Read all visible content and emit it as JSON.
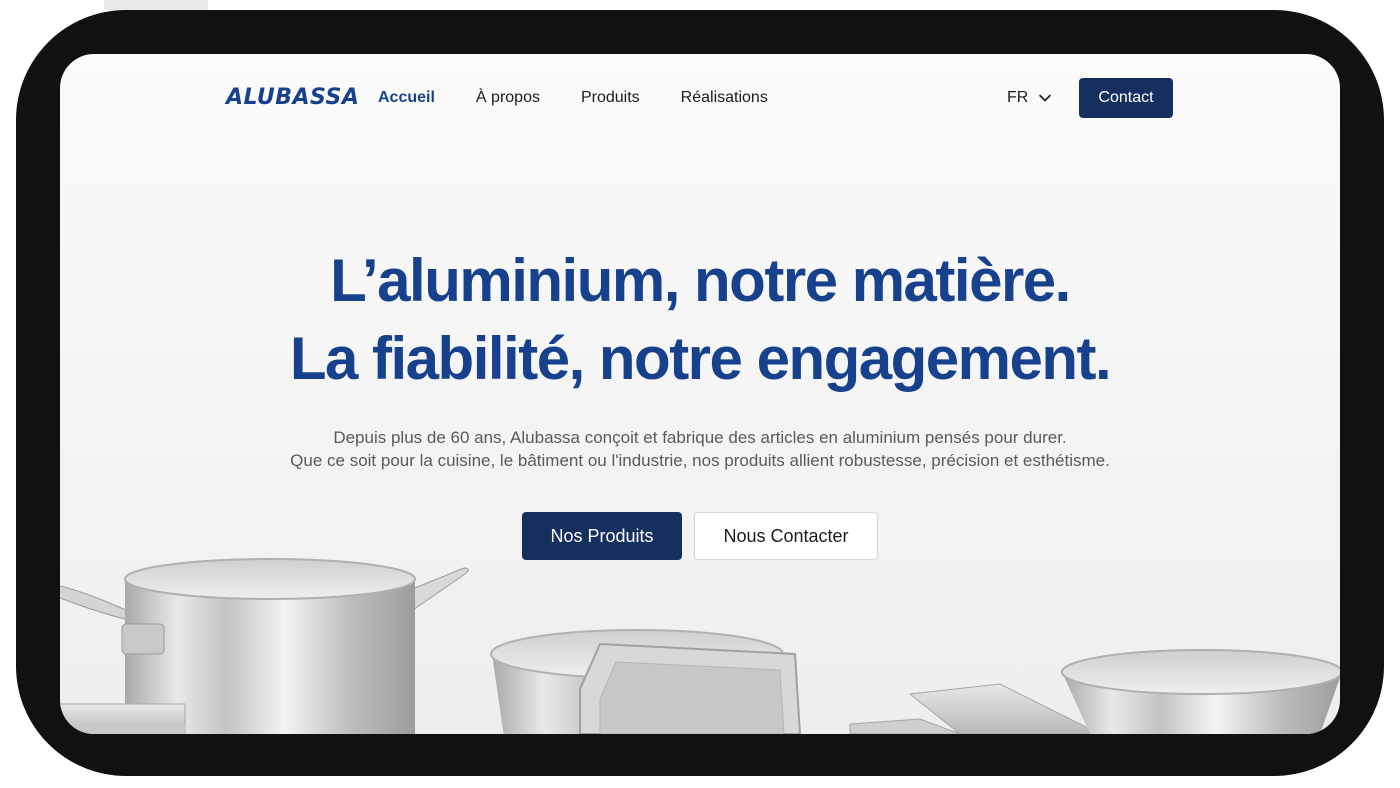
{
  "brand": {
    "logo_text": "ALUBASSA",
    "accent_color": "#17418c",
    "button_color": "#152f5f"
  },
  "nav": {
    "items": [
      {
        "label": "Accueil",
        "active": true
      },
      {
        "label": "À propos",
        "active": false
      },
      {
        "label": "Produits",
        "active": false
      },
      {
        "label": "Réalisations",
        "active": false
      }
    ]
  },
  "language": {
    "selected": "FR",
    "icon": "chevron-down-icon"
  },
  "header": {
    "contact_label": "Contact"
  },
  "hero": {
    "title_line1": "L’aluminium, notre matière.",
    "title_line2": "La fiabilité, notre engagement.",
    "desc_line1": "Depuis plus de 60 ans, Alubassa conçoit et fabrique des articles en aluminium pensés pour durer.",
    "desc_line2": "Que ce soit pour la cuisine, le bâtiment ou l'industrie, nos produits allient robustesse, précision et esthétisme.",
    "primary_button": "Nos Produits",
    "secondary_button": "Nous Contacter"
  }
}
